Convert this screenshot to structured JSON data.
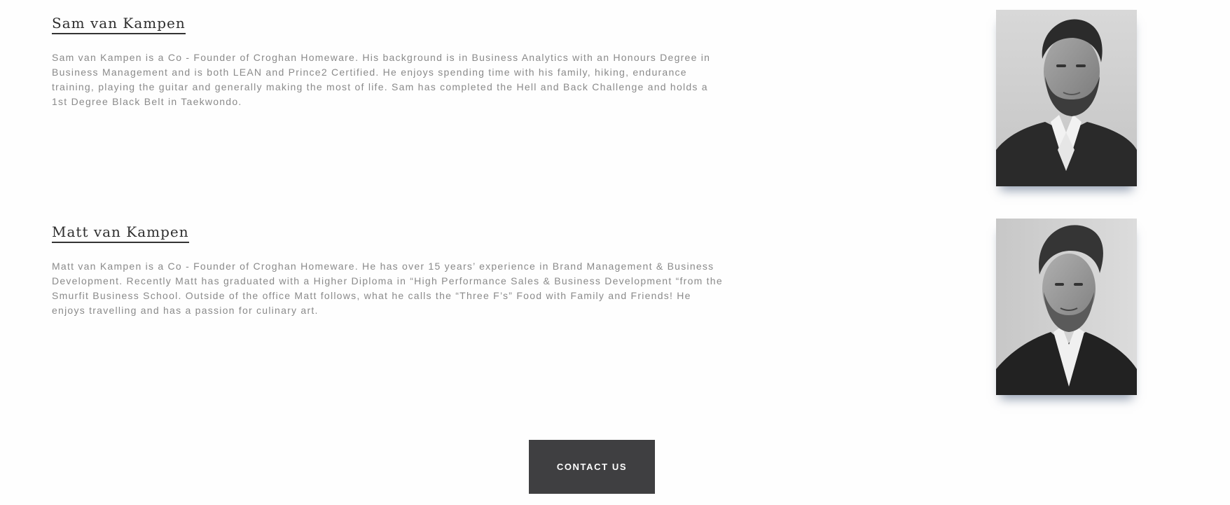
{
  "team": {
    "members": [
      {
        "name": "Sam van Kampen",
        "bio": "Sam van Kampen is a Co - Founder of Croghan Homeware. His background is in Business Analytics with an Honours Degree in Business Management and is both LEAN and Prince2 Certified. He enjoys spending time with his family, hiking, endurance training, playing the guitar and generally making the most of life. Sam has completed the Hell and Back Challenge and holds a 1st Degree Black Belt in Taekwondo."
      },
      {
        "name": "Matt van Kampen",
        "bio": "Matt van Kampen is a Co - Founder of Croghan Homeware. He has over 15 years’ experience in Brand Management & Business Development. Recently Matt has graduated with a Higher Diploma in “High Performance Sales & Business Development “from the Smurfit Business School. Outside of the office Matt follows, what he calls the “Three F’s” Food with Family and Friends! He enjoys travelling and has a passion for culinary art."
      }
    ]
  },
  "cta": {
    "contact_label": "CONTACT US"
  },
  "colors": {
    "name_text": "#2e2e2e",
    "bio_text": "#8a8a8a",
    "button_bg": "#3f3f41",
    "button_text": "#ffffff"
  }
}
